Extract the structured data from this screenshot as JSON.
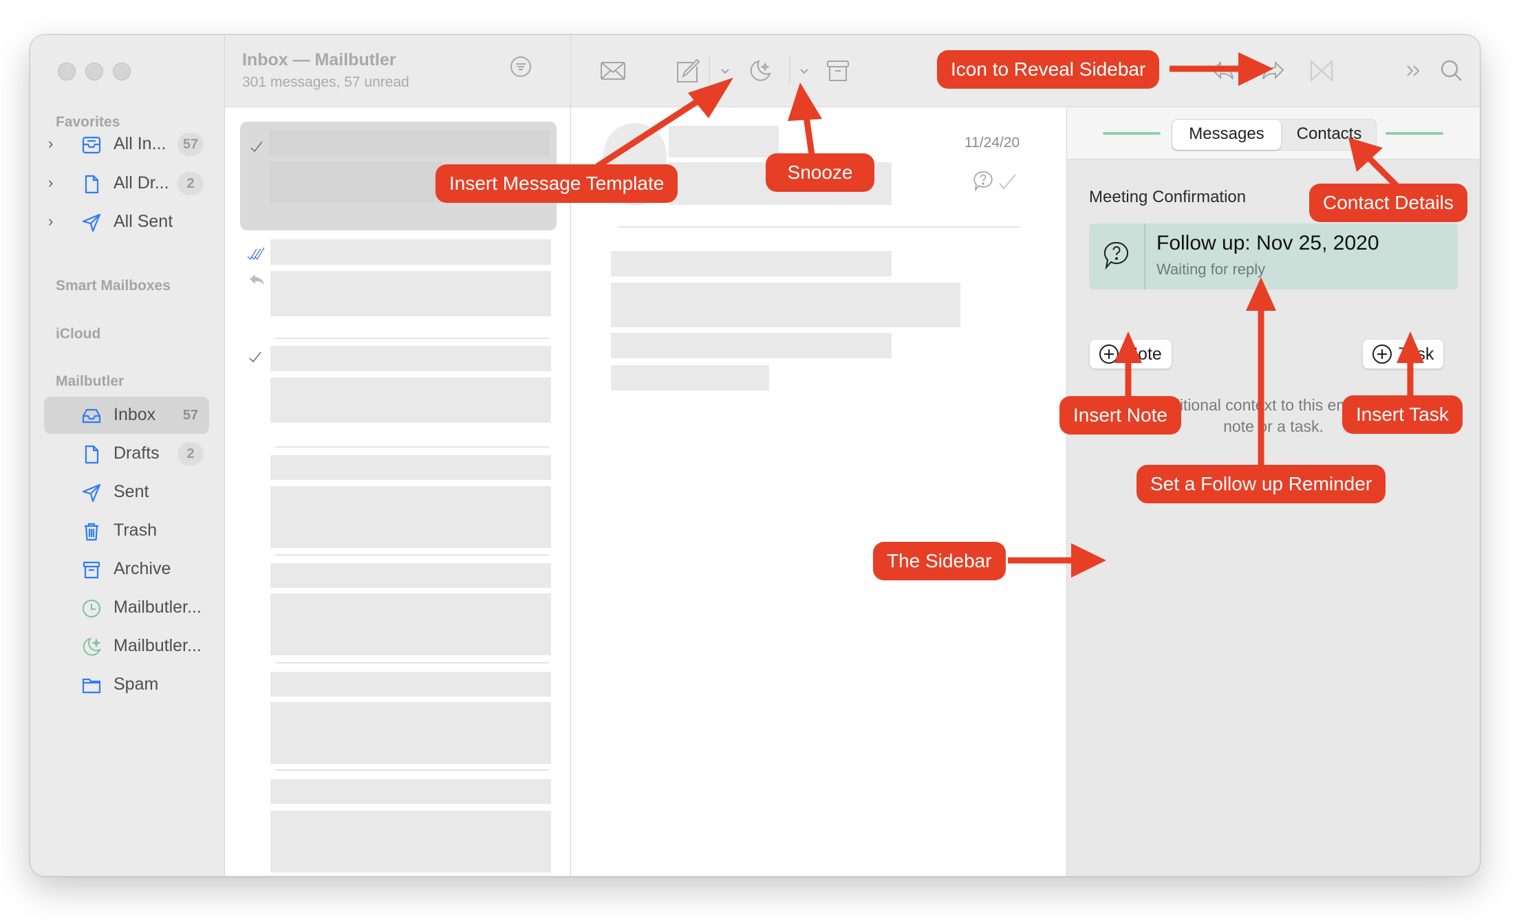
{
  "window": {
    "controls": [
      "close",
      "minimize",
      "zoom"
    ]
  },
  "sidebar": {
    "sections": {
      "favorites": "Favorites",
      "smart_mailboxes": "Smart Mailboxes",
      "icloud": "iCloud",
      "mailbutler": "Mailbutler"
    },
    "favorites": [
      {
        "label": "All In...",
        "icon": "inbox-tray-icon",
        "badge": "57"
      },
      {
        "label": "All Dr...",
        "icon": "document-icon",
        "badge": "2"
      },
      {
        "label": "All Sent",
        "icon": "paper-plane-icon",
        "badge": ""
      }
    ],
    "mailbutler": [
      {
        "label": "Inbox",
        "icon": "inbox-tray-icon",
        "badge": "57",
        "selected": true
      },
      {
        "label": "Drafts",
        "icon": "document-icon",
        "badge": "2"
      },
      {
        "label": "Sent",
        "icon": "paper-plane-icon",
        "badge": ""
      },
      {
        "label": "Trash",
        "icon": "trash-icon",
        "badge": ""
      },
      {
        "label": "Archive",
        "icon": "archive-box-icon",
        "badge": ""
      },
      {
        "label": "Mailbutler...",
        "icon": "clock-icon",
        "badge": ""
      },
      {
        "label": "Mailbutler...",
        "icon": "moon-snooze-icon",
        "badge": ""
      },
      {
        "label": "Spam",
        "icon": "folder-icon",
        "badge": ""
      }
    ]
  },
  "message_list": {
    "title": "Inbox — Mailbutler",
    "subtitle": "301 messages, 57 unread",
    "filter_icon": "filter-circle-icon"
  },
  "toolbar": {
    "buttons": [
      {
        "name": "get-mail",
        "icon": "envelope-icon"
      },
      {
        "name": "compose",
        "icon": "compose-icon"
      },
      {
        "name": "template-dropdown",
        "icon": "chevron-down-icon"
      },
      {
        "name": "snooze",
        "icon": "moon-snooze-icon"
      },
      {
        "name": "snooze-dropdown",
        "icon": "chevron-down-icon"
      },
      {
        "name": "archive",
        "icon": "archive-box-icon"
      },
      {
        "name": "reply",
        "icon": "reply-icon"
      },
      {
        "name": "forward",
        "icon": "forward-icon"
      },
      {
        "name": "mailbutler-sidebar",
        "icon": "mailbutler-logo-icon"
      },
      {
        "name": "more",
        "icon": "double-chevron-right-icon"
      },
      {
        "name": "search",
        "icon": "search-icon"
      }
    ]
  },
  "viewer": {
    "date": "11/24/20"
  },
  "mailbutler_panel": {
    "tabs": [
      {
        "label": "Messages",
        "active": true
      },
      {
        "label": "Contacts",
        "active": false
      }
    ],
    "subject": "Meeting Confirmation",
    "follow_up": {
      "title": "Follow up: Nov 25, 2020",
      "status": "Waiting for reply"
    },
    "note_button": "Note",
    "task_button": "Task",
    "hint": "Provide additional context to this email by adding a note or a task."
  },
  "annotations": {
    "accent": "#e63f26",
    "callouts": {
      "insert_template": "Insert Message Template",
      "snooze": "Snooze",
      "reveal_sidebar": "Icon to Reveal Sidebar",
      "contact_details": "Contact Details",
      "insert_note": "Insert Note",
      "insert_task": "Insert Task",
      "follow_up": "Set a Follow up Reminder",
      "the_sidebar": "The Sidebar"
    }
  },
  "colors": {
    "mail_blue": "#2f7cf6",
    "mailbutler_green": "#7fbfa6",
    "follow_up_bg": "#cbe0d9"
  }
}
